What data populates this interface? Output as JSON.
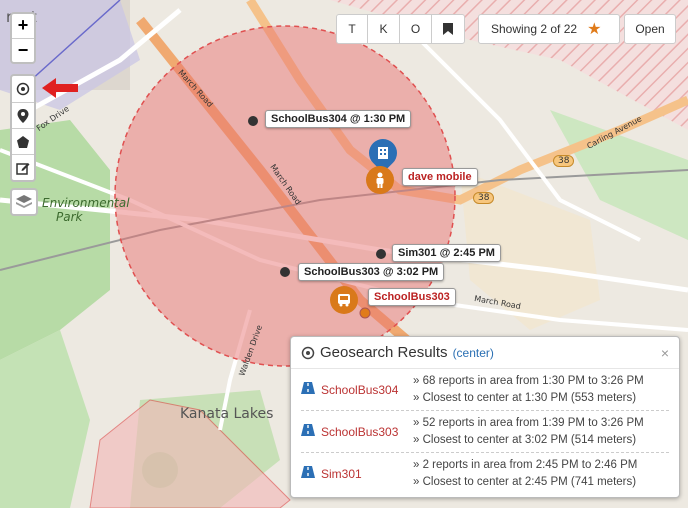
{
  "map": {
    "place_labels": {
      "top_left": "rant",
      "environmental": "Environmental",
      "park": "Park",
      "kanata_lakes": "Kanata Lakes"
    },
    "road_labels": {
      "march_road_1": "March Road",
      "march_road_2": "March Road",
      "march_road_3": "March Road",
      "carling_avenue": "Carling Avenue",
      "walden_drive": "Walden Drive",
      "fox_drive": "Fox Drive",
      "shield_38a": "38",
      "shield_38b": "38"
    }
  },
  "controls": {
    "zoom_in": "+",
    "zoom_out": "−"
  },
  "toolbar": {
    "btn_t": "T",
    "btn_k": "K",
    "btn_o": "O",
    "showing": "Showing 2 of 22",
    "open": "Open"
  },
  "markers": {
    "schoolbus304": "SchoolBus304 @ 1:30 PM",
    "dave": "dave mobile",
    "sim301": "Sim301 @ 2:45 PM",
    "schoolbus303_time": "SchoolBus303 @ 3:02 PM",
    "schoolbus303": "SchoolBus303"
  },
  "geosearch": {
    "title": "Geosearch Results",
    "center_link": "(center)",
    "close": "×",
    "results": [
      {
        "name": "SchoolBus304",
        "line1": "» 68 reports in area from 1:30 PM to 3:26 PM",
        "line2": "» Closest to center at 1:30 PM (553 meters)"
      },
      {
        "name": "SchoolBus303",
        "line1": "» 52 reports in area from 1:39 PM to 3:26 PM",
        "line2": "» Closest to center at 3:02 PM (514 meters)"
      },
      {
        "name": "Sim301",
        "line1": "» 2 reports in area from 2:45 PM to 2:46 PM",
        "line2": "» Closest to center at 2:45 PM (741 meters)"
      }
    ]
  },
  "colors": {
    "search_circle": "#e05050",
    "accent_orange": "#e07b1a",
    "link_blue": "#2a6fb3",
    "result_name": "#b33333"
  }
}
